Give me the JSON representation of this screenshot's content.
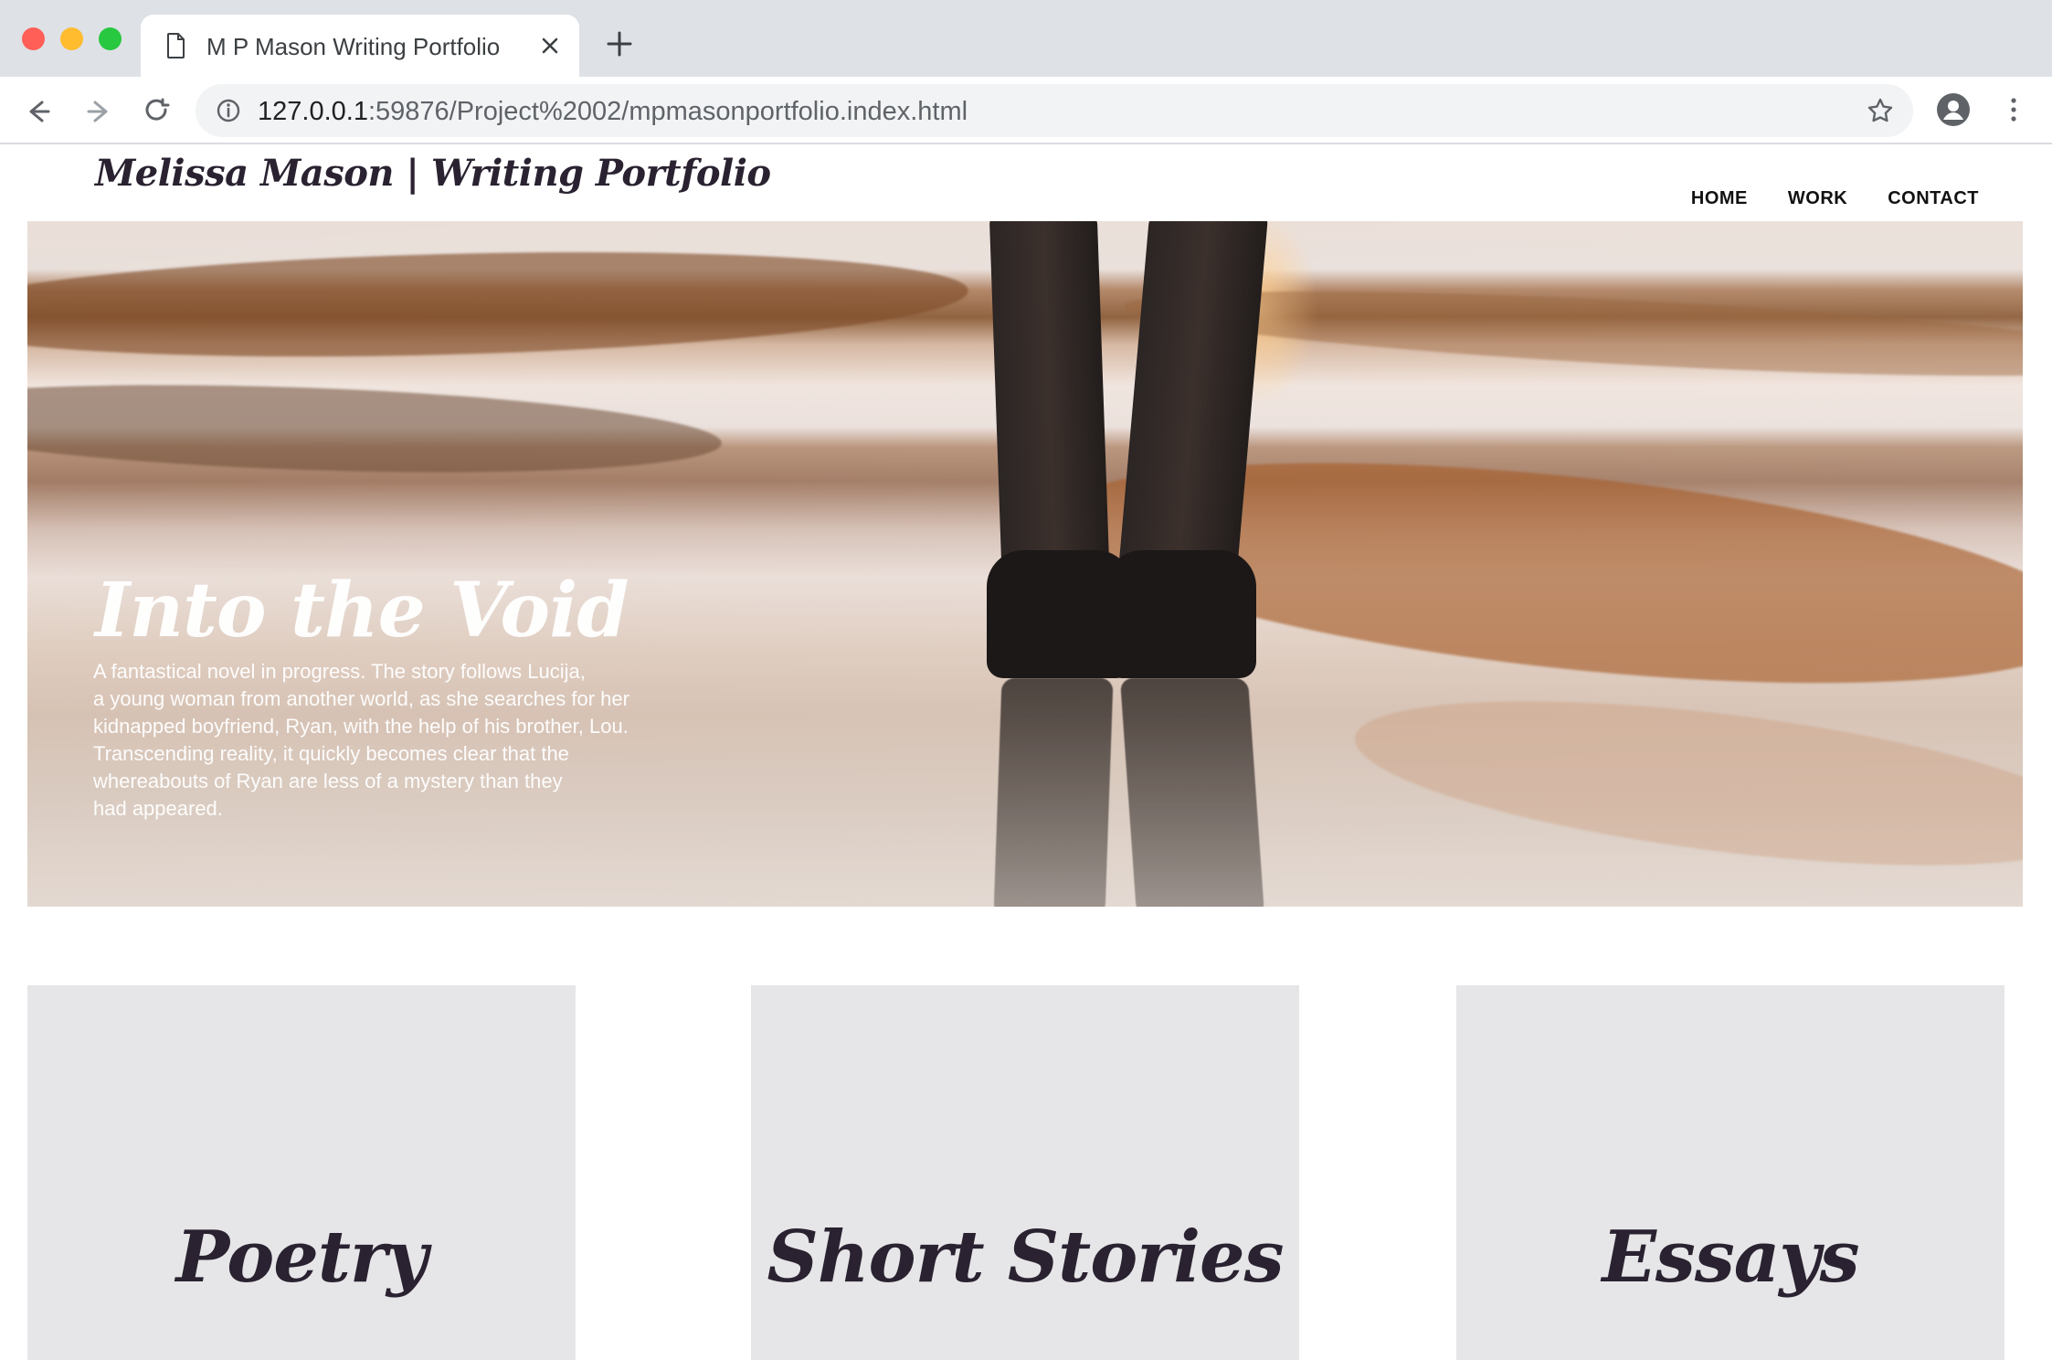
{
  "window": {
    "tab_title": "M P Mason Writing Portfolio",
    "url_host": "127.0.0.1",
    "url_rest": ":59876/Project%2002/mpmasonportfolio.index.html"
  },
  "site": {
    "brand": "Melissa Mason | Writing Portfolio",
    "nav": [
      "HOME",
      "WORK",
      "CONTACT"
    ]
  },
  "hero": {
    "title": "Into the Void",
    "text_lines": [
      "A fantastical novel in progress. The story follows Lucija,",
      "a young woman from another world, as she searches for her",
      "kidnapped boyfriend, Ryan, with the help of his brother, Lou.",
      "Transcending reality, it quickly becomes clear that the",
      "whereabouts of Ryan are less of a mystery than they",
      "had appeared."
    ]
  },
  "cards": [
    {
      "label": "Poetry"
    },
    {
      "label": "Short Stories"
    },
    {
      "label": "Essays"
    }
  ],
  "icons": {
    "tab": "document-icon",
    "tab_close": "close-icon",
    "new_tab": "plus-icon",
    "back": "arrow-left-icon",
    "forward": "arrow-right-icon",
    "reload": "reload-icon",
    "site_info": "info-icon",
    "bookmark": "star-icon",
    "profile": "account-icon",
    "menu": "kebab-menu-icon"
  },
  "colors": {
    "chrome": "#dee1e6",
    "card": "#e6e6e8",
    "brand_text": "#2a2230"
  }
}
